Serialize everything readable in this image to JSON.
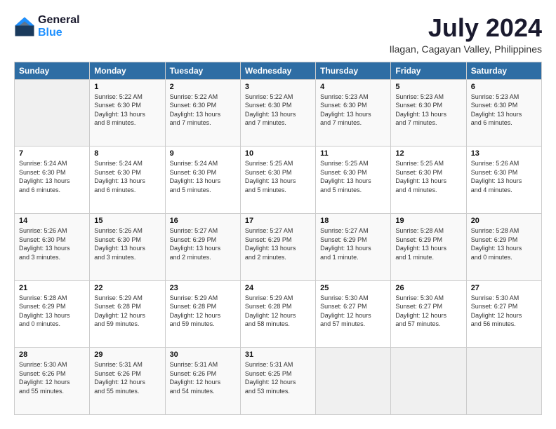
{
  "header": {
    "logo_line1": "General",
    "logo_line2": "Blue",
    "title": "July 2024",
    "subtitle": "Ilagan, Cagayan Valley, Philippines"
  },
  "days_of_week": [
    "Sunday",
    "Monday",
    "Tuesday",
    "Wednesday",
    "Thursday",
    "Friday",
    "Saturday"
  ],
  "weeks": [
    [
      {
        "day": "",
        "info": ""
      },
      {
        "day": "1",
        "info": "Sunrise: 5:22 AM\nSunset: 6:30 PM\nDaylight: 13 hours\nand 8 minutes."
      },
      {
        "day": "2",
        "info": "Sunrise: 5:22 AM\nSunset: 6:30 PM\nDaylight: 13 hours\nand 7 minutes."
      },
      {
        "day": "3",
        "info": "Sunrise: 5:22 AM\nSunset: 6:30 PM\nDaylight: 13 hours\nand 7 minutes."
      },
      {
        "day": "4",
        "info": "Sunrise: 5:23 AM\nSunset: 6:30 PM\nDaylight: 13 hours\nand 7 minutes."
      },
      {
        "day": "5",
        "info": "Sunrise: 5:23 AM\nSunset: 6:30 PM\nDaylight: 13 hours\nand 7 minutes."
      },
      {
        "day": "6",
        "info": "Sunrise: 5:23 AM\nSunset: 6:30 PM\nDaylight: 13 hours\nand 6 minutes."
      }
    ],
    [
      {
        "day": "7",
        "info": "Sunrise: 5:24 AM\nSunset: 6:30 PM\nDaylight: 13 hours\nand 6 minutes."
      },
      {
        "day": "8",
        "info": "Sunrise: 5:24 AM\nSunset: 6:30 PM\nDaylight: 13 hours\nand 6 minutes."
      },
      {
        "day": "9",
        "info": "Sunrise: 5:24 AM\nSunset: 6:30 PM\nDaylight: 13 hours\nand 5 minutes."
      },
      {
        "day": "10",
        "info": "Sunrise: 5:25 AM\nSunset: 6:30 PM\nDaylight: 13 hours\nand 5 minutes."
      },
      {
        "day": "11",
        "info": "Sunrise: 5:25 AM\nSunset: 6:30 PM\nDaylight: 13 hours\nand 5 minutes."
      },
      {
        "day": "12",
        "info": "Sunrise: 5:25 AM\nSunset: 6:30 PM\nDaylight: 13 hours\nand 4 minutes."
      },
      {
        "day": "13",
        "info": "Sunrise: 5:26 AM\nSunset: 6:30 PM\nDaylight: 13 hours\nand 4 minutes."
      }
    ],
    [
      {
        "day": "14",
        "info": "Sunrise: 5:26 AM\nSunset: 6:30 PM\nDaylight: 13 hours\nand 3 minutes."
      },
      {
        "day": "15",
        "info": "Sunrise: 5:26 AM\nSunset: 6:30 PM\nDaylight: 13 hours\nand 3 minutes."
      },
      {
        "day": "16",
        "info": "Sunrise: 5:27 AM\nSunset: 6:29 PM\nDaylight: 13 hours\nand 2 minutes."
      },
      {
        "day": "17",
        "info": "Sunrise: 5:27 AM\nSunset: 6:29 PM\nDaylight: 13 hours\nand 2 minutes."
      },
      {
        "day": "18",
        "info": "Sunrise: 5:27 AM\nSunset: 6:29 PM\nDaylight: 13 hours\nand 1 minute."
      },
      {
        "day": "19",
        "info": "Sunrise: 5:28 AM\nSunset: 6:29 PM\nDaylight: 13 hours\nand 1 minute."
      },
      {
        "day": "20",
        "info": "Sunrise: 5:28 AM\nSunset: 6:29 PM\nDaylight: 13 hours\nand 0 minutes."
      }
    ],
    [
      {
        "day": "21",
        "info": "Sunrise: 5:28 AM\nSunset: 6:29 PM\nDaylight: 13 hours\nand 0 minutes."
      },
      {
        "day": "22",
        "info": "Sunrise: 5:29 AM\nSunset: 6:28 PM\nDaylight: 12 hours\nand 59 minutes."
      },
      {
        "day": "23",
        "info": "Sunrise: 5:29 AM\nSunset: 6:28 PM\nDaylight: 12 hours\nand 59 minutes."
      },
      {
        "day": "24",
        "info": "Sunrise: 5:29 AM\nSunset: 6:28 PM\nDaylight: 12 hours\nand 58 minutes."
      },
      {
        "day": "25",
        "info": "Sunrise: 5:30 AM\nSunset: 6:27 PM\nDaylight: 12 hours\nand 57 minutes."
      },
      {
        "day": "26",
        "info": "Sunrise: 5:30 AM\nSunset: 6:27 PM\nDaylight: 12 hours\nand 57 minutes."
      },
      {
        "day": "27",
        "info": "Sunrise: 5:30 AM\nSunset: 6:27 PM\nDaylight: 12 hours\nand 56 minutes."
      }
    ],
    [
      {
        "day": "28",
        "info": "Sunrise: 5:30 AM\nSunset: 6:26 PM\nDaylight: 12 hours\nand 55 minutes."
      },
      {
        "day": "29",
        "info": "Sunrise: 5:31 AM\nSunset: 6:26 PM\nDaylight: 12 hours\nand 55 minutes."
      },
      {
        "day": "30",
        "info": "Sunrise: 5:31 AM\nSunset: 6:26 PM\nDaylight: 12 hours\nand 54 minutes."
      },
      {
        "day": "31",
        "info": "Sunrise: 5:31 AM\nSunset: 6:25 PM\nDaylight: 12 hours\nand 53 minutes."
      },
      {
        "day": "",
        "info": ""
      },
      {
        "day": "",
        "info": ""
      },
      {
        "day": "",
        "info": ""
      }
    ]
  ]
}
